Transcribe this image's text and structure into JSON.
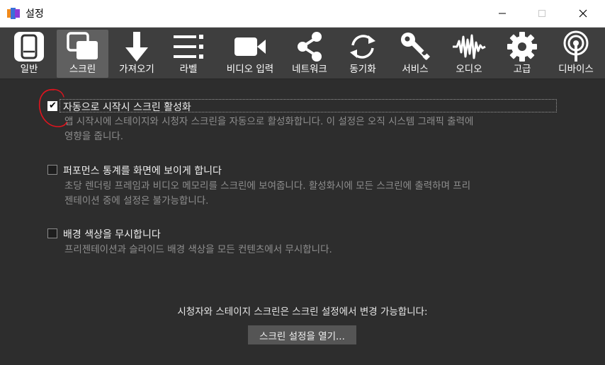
{
  "window": {
    "title": "설정"
  },
  "toolbar": {
    "items": [
      {
        "label": "일반",
        "icon": "general-icon"
      },
      {
        "label": "스크린",
        "icon": "screens-icon"
      },
      {
        "label": "가져오기",
        "icon": "import-icon"
      },
      {
        "label": "라벨",
        "icon": "labels-icon"
      },
      {
        "label": "비디오 입력",
        "icon": "video-camera-icon"
      },
      {
        "label": "네트워크",
        "icon": "share-network-icon"
      },
      {
        "label": "동기화",
        "icon": "sync-icon"
      },
      {
        "label": "서비스",
        "icon": "key-icon"
      },
      {
        "label": "오디오",
        "icon": "audio-waveform-icon"
      },
      {
        "label": "고급",
        "icon": "gear-icon"
      },
      {
        "label": "디바이스",
        "icon": "broadcast-icon"
      }
    ],
    "active_index": 1
  },
  "options": [
    {
      "label": "자동으로 시작시 스크린 활성화",
      "checked": true,
      "desc_lines": [
        "앱 시작시에 스테이지와 시청자 스크린을 자동으로 활성화합니다. 이 설정은 오직 시스템 그래픽 출력에",
        "영향을 줍니다."
      ]
    },
    {
      "label": "퍼포먼스 통계를 화면에 보이게 합니다",
      "checked": false,
      "desc_lines": [
        "초당 렌더링 프레임과 비디오 메모리를 스크린에 보여줍니다. 활성화시에 모든 스크린에 출력하며 프리",
        "젠테이션 중에 설정은 불가능합니다."
      ]
    },
    {
      "label": "배경 색상을 무시합니다",
      "checked": false,
      "desc_lines": [
        "프리젠테이션과 슬라이드 배경 색상을 모든 컨텐츠에서 무시합니다."
      ]
    }
  ],
  "note": "시청자와 스테이지 스크린은 스크린 설정에서 변경 가능합니다:",
  "open_button": "스크린 설정을 열기...",
  "colors": {
    "background": "#2d2d2d",
    "toolbar": "#3e3e3e",
    "active_tab": "#606060",
    "annotation": "#e0141e"
  }
}
